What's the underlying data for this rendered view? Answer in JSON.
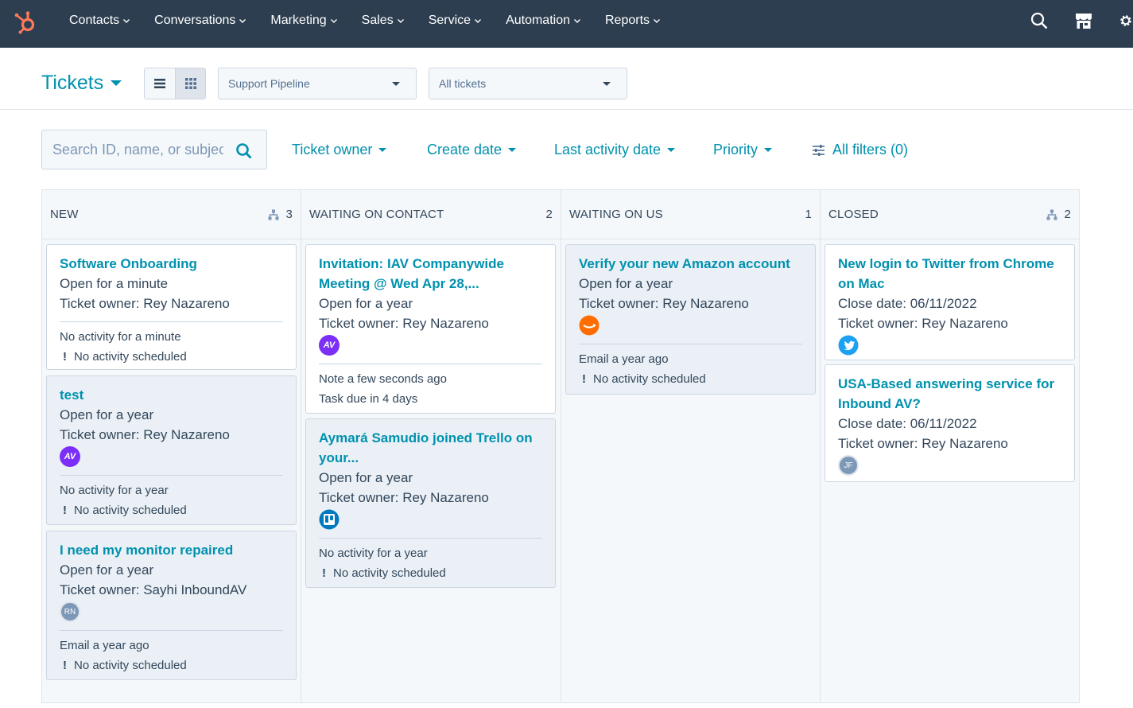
{
  "nav": {
    "items": [
      {
        "label": "Contacts"
      },
      {
        "label": "Conversations"
      },
      {
        "label": "Marketing"
      },
      {
        "label": "Sales"
      },
      {
        "label": "Service"
      },
      {
        "label": "Automation"
      },
      {
        "label": "Reports"
      }
    ],
    "icons": [
      "search-icon",
      "marketplace-icon",
      "settings-icon"
    ],
    "brand_color": "#ff7a59",
    "bar_color": "#2d3e50"
  },
  "header": {
    "title": "Tickets",
    "pipeline_select": "Support Pipeline",
    "view_select": "All tickets"
  },
  "filters": {
    "search_placeholder": "Search ID, name, or subject",
    "ticket_owner": "Ticket owner",
    "create_date": "Create date",
    "last_activity": "Last activity date",
    "priority": "Priority",
    "all_filters": "All filters (0)"
  },
  "columns": [
    {
      "name": "NEW",
      "count": "3",
      "cards": [
        {
          "title": "Software Onboarding",
          "status": "Open for a minute",
          "owner_label": "Ticket owner:",
          "owner": "Rey Nazareno",
          "foot1": "No activity for a minute",
          "foot2": "No activity scheduled"
        },
        {
          "title": "test",
          "status": "Open for a year",
          "owner_label": "Ticket owner:",
          "owner": "Rey Nazareno",
          "icon_text": "AV",
          "foot1": "No activity for a year",
          "foot2": "No activity scheduled"
        },
        {
          "title": "I need my monitor repaired",
          "status": "Open for a year",
          "owner_label": "Ticket owner:",
          "owner": "Sayhi InboundAV",
          "icon_text": "RN",
          "foot1": "Email a year ago",
          "foot2": "No activity scheduled"
        }
      ]
    },
    {
      "name": "WAITING ON CONTACT",
      "count": "2",
      "cards": [
        {
          "title": "Invitation: IAV Companywide Meeting @ Wed Apr 28,...",
          "status": "Open for a year",
          "owner_label": "Ticket owner:",
          "owner": "Rey Nazareno",
          "icon_text": "AV",
          "foot1": "Note a few seconds ago",
          "foot2": "Task due in 4 days"
        },
        {
          "title": "Aymará Samudio joined Trello on your...",
          "status": "Open for a year",
          "owner_label": "Ticket owner:",
          "owner": "Rey Nazareno",
          "foot1": "No activity for a year",
          "foot2": "No activity scheduled"
        }
      ]
    },
    {
      "name": "WAITING ON US",
      "count": "1",
      "cards": [
        {
          "title": "Verify your new Amazon account",
          "status": "Open for a year",
          "owner_label": "Ticket owner:",
          "owner": "Rey Nazareno",
          "foot1": "Email a year ago",
          "foot2": "No activity scheduled"
        }
      ]
    },
    {
      "name": "CLOSED",
      "count": "2",
      "cards": [
        {
          "title": "New login to Twitter from Chrome on Mac",
          "status": "Close date: 06/11/2022",
          "owner_label": "Ticket owner:",
          "owner": "Rey Nazareno"
        },
        {
          "title": "USA-Based answering service for Inbound AV?",
          "status": "Close date: 06/11/2022",
          "owner_label": "Ticket owner:",
          "owner": "Rey Nazareno",
          "icon_text": "JF"
        }
      ]
    }
  ]
}
